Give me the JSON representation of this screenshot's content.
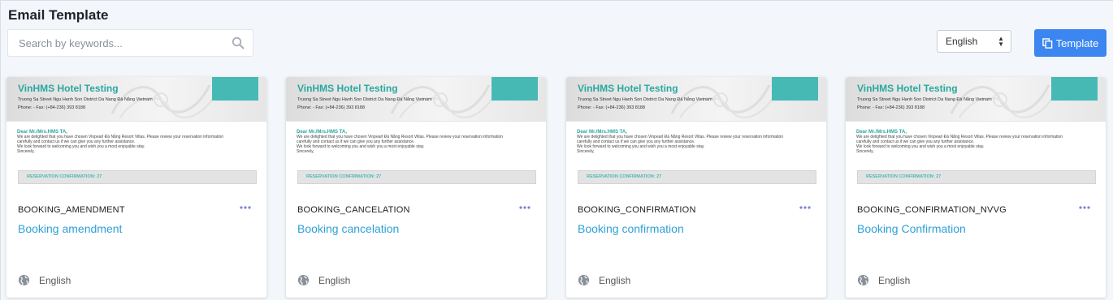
{
  "page": {
    "title": "Email Template"
  },
  "search": {
    "placeholder": "Search by keywords..."
  },
  "language_select": {
    "selected": "English"
  },
  "template_button": {
    "label": "Template"
  },
  "preview": {
    "hotel_name": "VinHMS Hotel Testing",
    "address": "Truong Sa Street Ngu Hanh Son District Da Nang Đà Nẵng Vietnam",
    "phone": "Phone: - Fax: (+84-236) 393 8188",
    "greeting": "Dear Mr./Mrs.HMS TA,",
    "lines": [
      "We are delighted that you have chosen Vinpearl Đà Nẵng Resort Villas. Please review your reservation information",
      "carefully and contact us if we can give you any further assistance.",
      "We look forward to welcoming you and wish you a most enjoyable stay.",
      "Sincerely,"
    ],
    "reservation_label": "RESERVATION CONFIRMATION: 27"
  },
  "cards": [
    {
      "code": "BOOKING_AMENDMENT",
      "name": "Booking amendment",
      "language": "English"
    },
    {
      "code": "BOOKING_CANCELATION",
      "name": "Booking cancelation",
      "language": "English"
    },
    {
      "code": "BOOKING_CONFIRMATION",
      "name": "Booking confirmation",
      "language": "English"
    },
    {
      "code": "BOOKING_CONFIRMATION_NVVG",
      "name": "Booking Confirmation",
      "language": "English"
    }
  ],
  "colors": {
    "accent_blue": "#3b86f0",
    "link": "#2ea1d6",
    "teal": "#47b9b5"
  }
}
